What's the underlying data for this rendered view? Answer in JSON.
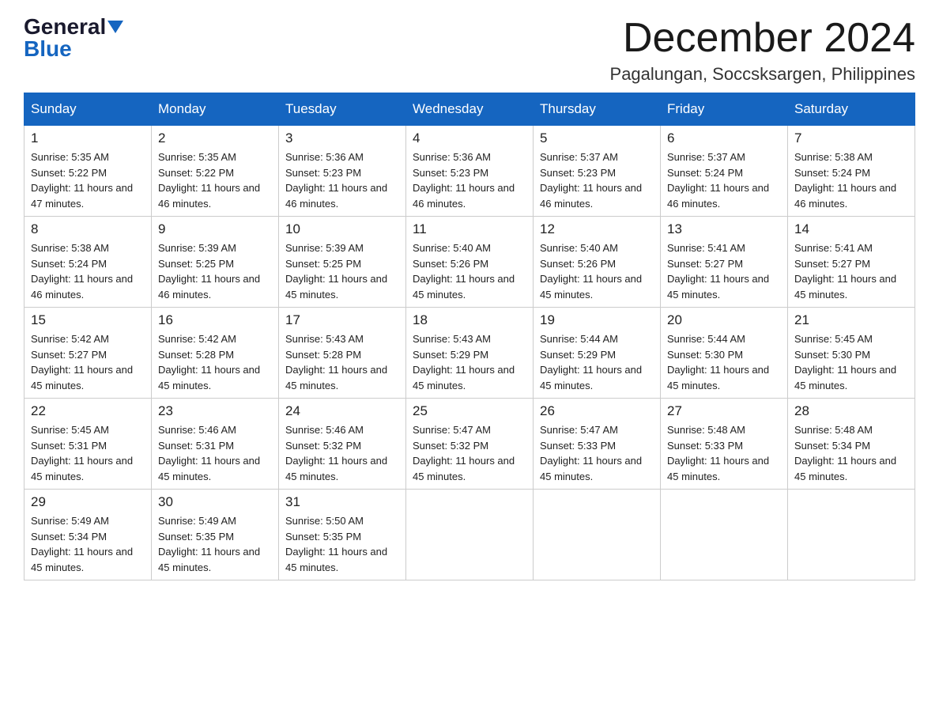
{
  "logo": {
    "general": "General",
    "blue": "Blue"
  },
  "title": "December 2024",
  "location": "Pagalungan, Soccsksargen, Philippines",
  "weekdays": [
    "Sunday",
    "Monday",
    "Tuesday",
    "Wednesday",
    "Thursday",
    "Friday",
    "Saturday"
  ],
  "weeks": [
    [
      {
        "day": "1",
        "sunrise": "5:35 AM",
        "sunset": "5:22 PM",
        "daylight": "11 hours and 47 minutes."
      },
      {
        "day": "2",
        "sunrise": "5:35 AM",
        "sunset": "5:22 PM",
        "daylight": "11 hours and 46 minutes."
      },
      {
        "day": "3",
        "sunrise": "5:36 AM",
        "sunset": "5:23 PM",
        "daylight": "11 hours and 46 minutes."
      },
      {
        "day": "4",
        "sunrise": "5:36 AM",
        "sunset": "5:23 PM",
        "daylight": "11 hours and 46 minutes."
      },
      {
        "day": "5",
        "sunrise": "5:37 AM",
        "sunset": "5:23 PM",
        "daylight": "11 hours and 46 minutes."
      },
      {
        "day": "6",
        "sunrise": "5:37 AM",
        "sunset": "5:24 PM",
        "daylight": "11 hours and 46 minutes."
      },
      {
        "day": "7",
        "sunrise": "5:38 AM",
        "sunset": "5:24 PM",
        "daylight": "11 hours and 46 minutes."
      }
    ],
    [
      {
        "day": "8",
        "sunrise": "5:38 AM",
        "sunset": "5:24 PM",
        "daylight": "11 hours and 46 minutes."
      },
      {
        "day": "9",
        "sunrise": "5:39 AM",
        "sunset": "5:25 PM",
        "daylight": "11 hours and 46 minutes."
      },
      {
        "day": "10",
        "sunrise": "5:39 AM",
        "sunset": "5:25 PM",
        "daylight": "11 hours and 45 minutes."
      },
      {
        "day": "11",
        "sunrise": "5:40 AM",
        "sunset": "5:26 PM",
        "daylight": "11 hours and 45 minutes."
      },
      {
        "day": "12",
        "sunrise": "5:40 AM",
        "sunset": "5:26 PM",
        "daylight": "11 hours and 45 minutes."
      },
      {
        "day": "13",
        "sunrise": "5:41 AM",
        "sunset": "5:27 PM",
        "daylight": "11 hours and 45 minutes."
      },
      {
        "day": "14",
        "sunrise": "5:41 AM",
        "sunset": "5:27 PM",
        "daylight": "11 hours and 45 minutes."
      }
    ],
    [
      {
        "day": "15",
        "sunrise": "5:42 AM",
        "sunset": "5:27 PM",
        "daylight": "11 hours and 45 minutes."
      },
      {
        "day": "16",
        "sunrise": "5:42 AM",
        "sunset": "5:28 PM",
        "daylight": "11 hours and 45 minutes."
      },
      {
        "day": "17",
        "sunrise": "5:43 AM",
        "sunset": "5:28 PM",
        "daylight": "11 hours and 45 minutes."
      },
      {
        "day": "18",
        "sunrise": "5:43 AM",
        "sunset": "5:29 PM",
        "daylight": "11 hours and 45 minutes."
      },
      {
        "day": "19",
        "sunrise": "5:44 AM",
        "sunset": "5:29 PM",
        "daylight": "11 hours and 45 minutes."
      },
      {
        "day": "20",
        "sunrise": "5:44 AM",
        "sunset": "5:30 PM",
        "daylight": "11 hours and 45 minutes."
      },
      {
        "day": "21",
        "sunrise": "5:45 AM",
        "sunset": "5:30 PM",
        "daylight": "11 hours and 45 minutes."
      }
    ],
    [
      {
        "day": "22",
        "sunrise": "5:45 AM",
        "sunset": "5:31 PM",
        "daylight": "11 hours and 45 minutes."
      },
      {
        "day": "23",
        "sunrise": "5:46 AM",
        "sunset": "5:31 PM",
        "daylight": "11 hours and 45 minutes."
      },
      {
        "day": "24",
        "sunrise": "5:46 AM",
        "sunset": "5:32 PM",
        "daylight": "11 hours and 45 minutes."
      },
      {
        "day": "25",
        "sunrise": "5:47 AM",
        "sunset": "5:32 PM",
        "daylight": "11 hours and 45 minutes."
      },
      {
        "day": "26",
        "sunrise": "5:47 AM",
        "sunset": "5:33 PM",
        "daylight": "11 hours and 45 minutes."
      },
      {
        "day": "27",
        "sunrise": "5:48 AM",
        "sunset": "5:33 PM",
        "daylight": "11 hours and 45 minutes."
      },
      {
        "day": "28",
        "sunrise": "5:48 AM",
        "sunset": "5:34 PM",
        "daylight": "11 hours and 45 minutes."
      }
    ],
    [
      {
        "day": "29",
        "sunrise": "5:49 AM",
        "sunset": "5:34 PM",
        "daylight": "11 hours and 45 minutes."
      },
      {
        "day": "30",
        "sunrise": "5:49 AM",
        "sunset": "5:35 PM",
        "daylight": "11 hours and 45 minutes."
      },
      {
        "day": "31",
        "sunrise": "5:50 AM",
        "sunset": "5:35 PM",
        "daylight": "11 hours and 45 minutes."
      },
      null,
      null,
      null,
      null
    ]
  ],
  "labels": {
    "sunrise": "Sunrise:",
    "sunset": "Sunset:",
    "daylight": "Daylight:"
  }
}
